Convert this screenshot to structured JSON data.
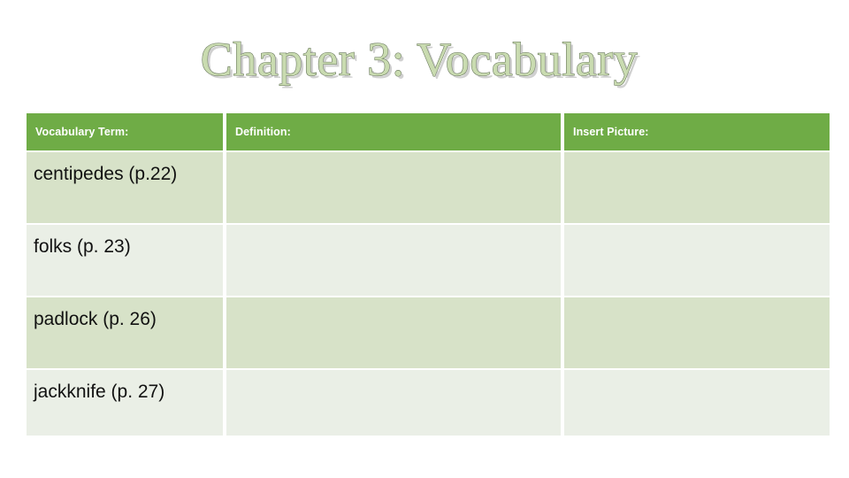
{
  "slide": {
    "title": "Chapter 3: Vocabulary",
    "title_fill_color": "#c9dbb0",
    "title_outline_color": "#5f6f52",
    "background_color": "#ffffff"
  },
  "table": {
    "header_background_color": "#6fac46",
    "header_text_color": "#ffffff",
    "row_band_a_color": "#d7e2c8",
    "row_band_b_color": "#eaefe6",
    "columns": [
      {
        "key": "term",
        "label": "Vocabulary Term:"
      },
      {
        "key": "definition",
        "label": "Definition:"
      },
      {
        "key": "picture",
        "label": "Insert Picture:"
      }
    ],
    "rows": [
      {
        "term": "centipedes (p.22)",
        "definition": "",
        "picture": ""
      },
      {
        "term": "folks (p. 23)",
        "definition": "",
        "picture": ""
      },
      {
        "term": "padlock (p. 26)",
        "definition": "",
        "picture": ""
      },
      {
        "term": "jackknife (p. 27)",
        "definition": "",
        "picture": ""
      }
    ]
  }
}
